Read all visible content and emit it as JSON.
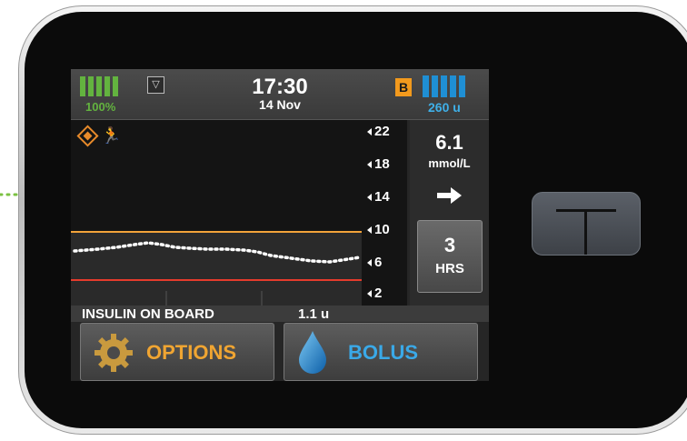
{
  "status": {
    "battery_percent": "100%",
    "time": "17:30",
    "date": "14 Nov",
    "badge": "B",
    "insulin_units": "260 u",
    "battery_color": "#63b33f",
    "insulin_color": "#1f8fd4"
  },
  "graph": {
    "icons": [
      "diamond-icon",
      "runner-icon"
    ],
    "axis_labels": [
      "22",
      "18",
      "14",
      "10",
      "6",
      "2"
    ],
    "high_line_color": "#f2a33a",
    "low_line_color": "#e53b2c"
  },
  "reading": {
    "value": "6.1",
    "unit": "mmol/L",
    "trend": "right-arrow-icon"
  },
  "timescale": {
    "hours": "3",
    "label": "HRS"
  },
  "iob": {
    "label": "INSULIN ON BOARD",
    "value": "1.1 u"
  },
  "buttons": {
    "options": "OPTIONS",
    "bolus": "BOLUS",
    "options_color": "#f0a532",
    "bolus_color": "#3aa9e8"
  }
}
